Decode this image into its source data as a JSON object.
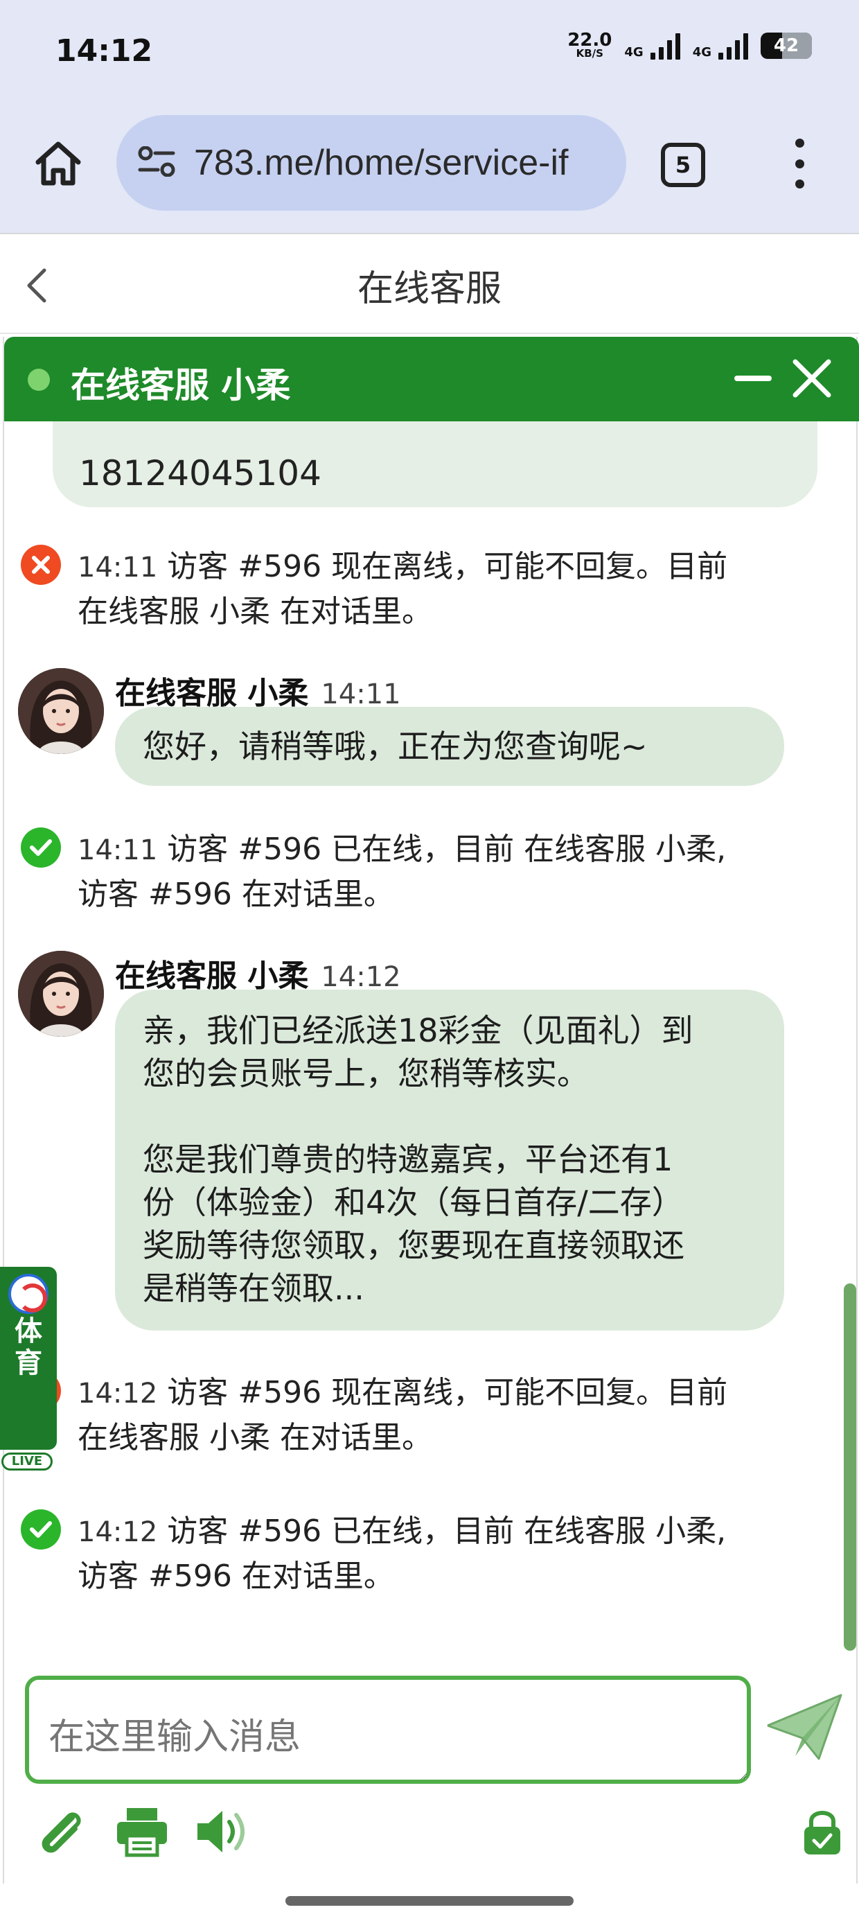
{
  "status_bar": {
    "time": "14:12",
    "net_speed": "22.0",
    "net_speed_unit": "KB/S",
    "network_1": "4G",
    "network_2": "4G",
    "battery": "42"
  },
  "browser": {
    "url": "783.me/home/service-if",
    "tab_count": "5"
  },
  "page": {
    "title": "在线客服"
  },
  "chat": {
    "header_title": "在线客服 小柔",
    "partial_message": "18124045104",
    "messages": [
      {
        "type": "system-offline",
        "time": "14:11",
        "text": "访客 #596 现在离线，可能不回复。目前",
        "text2": "在线客服 小柔 在对话里。"
      },
      {
        "type": "agent",
        "name": "在线客服 小柔",
        "time": "14:11",
        "lines": [
          "您好，请稍等哦，正在为您查询呢~"
        ]
      },
      {
        "type": "system-online",
        "time": "14:11",
        "text": "访客 #596 已在线，目前 在线客服 小柔,",
        "text2": "访客 #596 在对话里。"
      },
      {
        "type": "agent",
        "name": "在线客服 小柔",
        "time": "14:12",
        "lines": [
          "亲，我们已经派送18彩金（见面礼）到",
          "您的会员账号上，您稍等核实。",
          "",
          "您是我们尊贵的特邀嘉宾，平台还有1",
          "份（体验金）和4次（每日首存/二存）",
          "奖励等待您领取，您要现在直接领取还",
          "是稍等在领取..."
        ]
      },
      {
        "type": "system-offline",
        "time": "14:12",
        "text": "访客 #596 现在离线，可能不回复。目前",
        "text2": "在线客服 小柔 在对话里。"
      },
      {
        "type": "system-online",
        "time": "14:12",
        "text": "访客 #596 已在线，目前 在线客服 小柔,",
        "text2": "访客 #596 在对话里。"
      }
    ],
    "input_placeholder": "在这里输入消息"
  },
  "sports_badge": {
    "line1": "体",
    "line2": "育",
    "live": "LIVE"
  },
  "icons": {
    "home": "home-icon",
    "site_info": "tune-icon",
    "menu": "more-vert-icon",
    "back": "chevron-left-icon",
    "minimize": "minimize-icon",
    "close": "close-icon",
    "send": "paper-plane-icon",
    "attach": "paperclip-icon",
    "print": "printer-icon",
    "sound": "speaker-icon",
    "secure": "lock-icon"
  },
  "colors": {
    "brand_green": "#1e8a29",
    "bubble": "#dbe9db",
    "offline": "#ef4a21",
    "online": "#2bb52b",
    "browser_bg": "#e3e7f6"
  }
}
